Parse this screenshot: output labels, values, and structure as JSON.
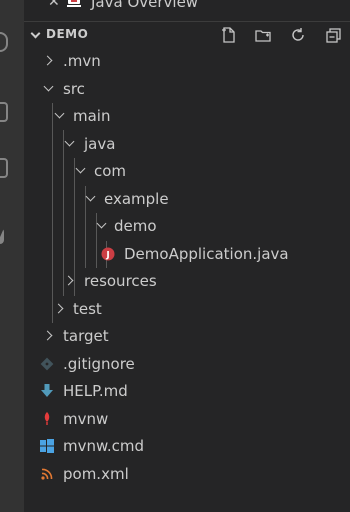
{
  "open_editors": {
    "close_glyph": "✕",
    "file_label": "Java Overview"
  },
  "explorer": {
    "section_title": "DEMO",
    "actions": [
      "new-file-icon",
      "new-folder-icon",
      "refresh-icon",
      "collapse-all-icon"
    ]
  },
  "tree": [
    {
      "label": ".mvn",
      "state": "closed"
    },
    {
      "label": "src",
      "state": "open"
    },
    {
      "label": "main",
      "state": "open"
    },
    {
      "label": "java",
      "state": "open"
    },
    {
      "label": "com",
      "state": "open"
    },
    {
      "label": "example",
      "state": "open"
    },
    {
      "label": "demo",
      "state": "open"
    },
    {
      "label": "DemoApplication.java",
      "icon": "java-file-icon"
    },
    {
      "label": "resources",
      "state": "closed"
    },
    {
      "label": "test",
      "state": "closed"
    },
    {
      "label": "target",
      "state": "closed"
    },
    {
      "label": ".gitignore",
      "icon": "git-file-icon"
    },
    {
      "label": "HELP.md",
      "icon": "markdown-file-icon"
    },
    {
      "label": "mvnw",
      "icon": "maven-file-icon"
    },
    {
      "label": "mvnw.cmd",
      "icon": "windows-file-icon"
    },
    {
      "label": "pom.xml",
      "icon": "xml-rss-file-icon"
    }
  ],
  "colors": {
    "java_icon": "#cc3e44",
    "git_icon": "#41535b",
    "markdown_icon": "#519aba",
    "maven_icon": "#e53b3b",
    "windows_icon": "#4ba3e3",
    "xml_icon": "#e37933"
  }
}
